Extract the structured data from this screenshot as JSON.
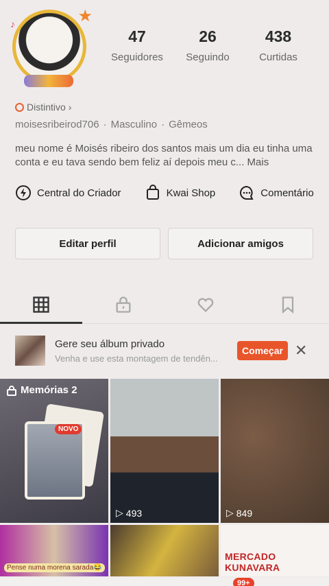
{
  "profile": {
    "stats": [
      {
        "value": "47",
        "label": "Seguidores"
      },
      {
        "value": "26",
        "label": "Seguindo"
      },
      {
        "value": "438",
        "label": "Curtidas"
      }
    ],
    "badge": "Distintivo",
    "username": "moisesribeirod706",
    "gender": "Masculino",
    "sign": "Gêmeos",
    "bio": "meu nome é Moisés ribeiro dos santos mais um dia eu tinha uma conta e eu tava sendo bem feliz aí depois meu c...",
    "bio_more": "Mais"
  },
  "tools": [
    {
      "label": "Central do Criador",
      "icon": "lightning-icon"
    },
    {
      "label": "Kwai Shop",
      "icon": "shopping-bag-icon"
    },
    {
      "label": "Comentário",
      "icon": "comment-icon"
    }
  ],
  "buttons": {
    "edit": "Editar perfil",
    "add": "Adicionar amigos"
  },
  "promo": {
    "title": "Gere seu álbum privado",
    "subtitle": "Venha e use esta montagem de tendên...",
    "cta": "Começar"
  },
  "grid": {
    "memories_title": "Memórias 2",
    "new_badge": "NOVO",
    "views": [
      "493",
      "849"
    ],
    "caption4": "Pense numa morena sarada😂",
    "market_text": "MERCADO KUNAVARA"
  },
  "nav": {
    "badge": "99+"
  },
  "colors": {
    "accent": "#e8552a",
    "background": "#efebeb"
  }
}
